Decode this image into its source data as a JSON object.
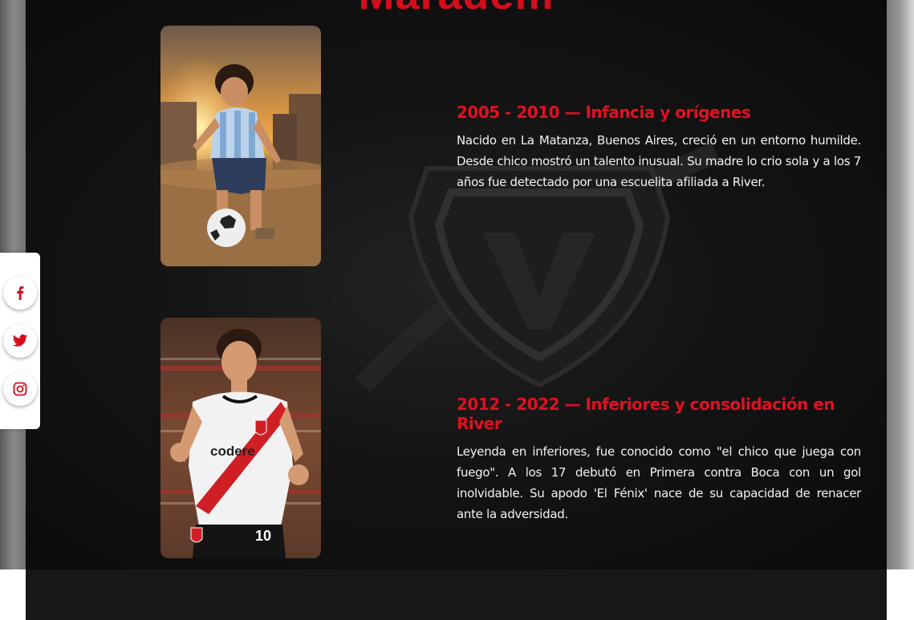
{
  "page": {
    "title": "Maradem"
  },
  "timeline": [
    {
      "heading": "2005 - 2010 — Infancia y orígenes",
      "text": "Nacido en La Matanza, Buenos Aires, creció en un entorno humilde. Desde chico mostró un talento inusual. Su madre lo crio sola y a los 7 años fue detectado por una escuelita afiliada a River."
    },
    {
      "heading": "2012 - 2022 — Inferiores y consolidación en River",
      "text": "Leyenda en inferiores, fue conocido como \"el chico que juega con fuego\". A los 17 debutó en Primera contra Boca con un gol inolvidable. Su apodo 'El Fénix' nace de su capacidad de renacer ante la adversidad."
    }
  ],
  "photos": {
    "jersey_brand": "codere",
    "jersey_number": "10"
  },
  "social": {
    "items": [
      "facebook-icon",
      "twitter-icon",
      "instagram-icon"
    ],
    "icon_color": "#d40d1d"
  },
  "colors": {
    "accent": "#e1101f",
    "background": "#0f0f0f"
  }
}
